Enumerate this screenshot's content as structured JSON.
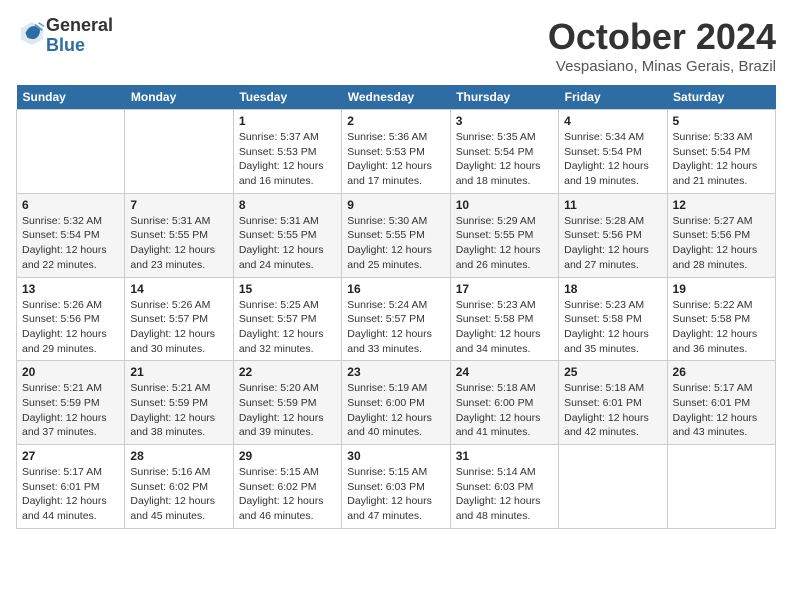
{
  "header": {
    "logo_line1": "General",
    "logo_line2": "Blue",
    "month": "October 2024",
    "location": "Vespasiano, Minas Gerais, Brazil"
  },
  "weekdays": [
    "Sunday",
    "Monday",
    "Tuesday",
    "Wednesday",
    "Thursday",
    "Friday",
    "Saturday"
  ],
  "weeks": [
    [
      {
        "day": "",
        "info": ""
      },
      {
        "day": "",
        "info": ""
      },
      {
        "day": "1",
        "info": "Sunrise: 5:37 AM\nSunset: 5:53 PM\nDaylight: 12 hours and 16 minutes."
      },
      {
        "day": "2",
        "info": "Sunrise: 5:36 AM\nSunset: 5:53 PM\nDaylight: 12 hours and 17 minutes."
      },
      {
        "day": "3",
        "info": "Sunrise: 5:35 AM\nSunset: 5:54 PM\nDaylight: 12 hours and 18 minutes."
      },
      {
        "day": "4",
        "info": "Sunrise: 5:34 AM\nSunset: 5:54 PM\nDaylight: 12 hours and 19 minutes."
      },
      {
        "day": "5",
        "info": "Sunrise: 5:33 AM\nSunset: 5:54 PM\nDaylight: 12 hours and 21 minutes."
      }
    ],
    [
      {
        "day": "6",
        "info": "Sunrise: 5:32 AM\nSunset: 5:54 PM\nDaylight: 12 hours and 22 minutes."
      },
      {
        "day": "7",
        "info": "Sunrise: 5:31 AM\nSunset: 5:55 PM\nDaylight: 12 hours and 23 minutes."
      },
      {
        "day": "8",
        "info": "Sunrise: 5:31 AM\nSunset: 5:55 PM\nDaylight: 12 hours and 24 minutes."
      },
      {
        "day": "9",
        "info": "Sunrise: 5:30 AM\nSunset: 5:55 PM\nDaylight: 12 hours and 25 minutes."
      },
      {
        "day": "10",
        "info": "Sunrise: 5:29 AM\nSunset: 5:55 PM\nDaylight: 12 hours and 26 minutes."
      },
      {
        "day": "11",
        "info": "Sunrise: 5:28 AM\nSunset: 5:56 PM\nDaylight: 12 hours and 27 minutes."
      },
      {
        "day": "12",
        "info": "Sunrise: 5:27 AM\nSunset: 5:56 PM\nDaylight: 12 hours and 28 minutes."
      }
    ],
    [
      {
        "day": "13",
        "info": "Sunrise: 5:26 AM\nSunset: 5:56 PM\nDaylight: 12 hours and 29 minutes."
      },
      {
        "day": "14",
        "info": "Sunrise: 5:26 AM\nSunset: 5:57 PM\nDaylight: 12 hours and 30 minutes."
      },
      {
        "day": "15",
        "info": "Sunrise: 5:25 AM\nSunset: 5:57 PM\nDaylight: 12 hours and 32 minutes."
      },
      {
        "day": "16",
        "info": "Sunrise: 5:24 AM\nSunset: 5:57 PM\nDaylight: 12 hours and 33 minutes."
      },
      {
        "day": "17",
        "info": "Sunrise: 5:23 AM\nSunset: 5:58 PM\nDaylight: 12 hours and 34 minutes."
      },
      {
        "day": "18",
        "info": "Sunrise: 5:23 AM\nSunset: 5:58 PM\nDaylight: 12 hours and 35 minutes."
      },
      {
        "day": "19",
        "info": "Sunrise: 5:22 AM\nSunset: 5:58 PM\nDaylight: 12 hours and 36 minutes."
      }
    ],
    [
      {
        "day": "20",
        "info": "Sunrise: 5:21 AM\nSunset: 5:59 PM\nDaylight: 12 hours and 37 minutes."
      },
      {
        "day": "21",
        "info": "Sunrise: 5:21 AM\nSunset: 5:59 PM\nDaylight: 12 hours and 38 minutes."
      },
      {
        "day": "22",
        "info": "Sunrise: 5:20 AM\nSunset: 5:59 PM\nDaylight: 12 hours and 39 minutes."
      },
      {
        "day": "23",
        "info": "Sunrise: 5:19 AM\nSunset: 6:00 PM\nDaylight: 12 hours and 40 minutes."
      },
      {
        "day": "24",
        "info": "Sunrise: 5:18 AM\nSunset: 6:00 PM\nDaylight: 12 hours and 41 minutes."
      },
      {
        "day": "25",
        "info": "Sunrise: 5:18 AM\nSunset: 6:01 PM\nDaylight: 12 hours and 42 minutes."
      },
      {
        "day": "26",
        "info": "Sunrise: 5:17 AM\nSunset: 6:01 PM\nDaylight: 12 hours and 43 minutes."
      }
    ],
    [
      {
        "day": "27",
        "info": "Sunrise: 5:17 AM\nSunset: 6:01 PM\nDaylight: 12 hours and 44 minutes."
      },
      {
        "day": "28",
        "info": "Sunrise: 5:16 AM\nSunset: 6:02 PM\nDaylight: 12 hours and 45 minutes."
      },
      {
        "day": "29",
        "info": "Sunrise: 5:15 AM\nSunset: 6:02 PM\nDaylight: 12 hours and 46 minutes."
      },
      {
        "day": "30",
        "info": "Sunrise: 5:15 AM\nSunset: 6:03 PM\nDaylight: 12 hours and 47 minutes."
      },
      {
        "day": "31",
        "info": "Sunrise: 5:14 AM\nSunset: 6:03 PM\nDaylight: 12 hours and 48 minutes."
      },
      {
        "day": "",
        "info": ""
      },
      {
        "day": "",
        "info": ""
      }
    ]
  ]
}
